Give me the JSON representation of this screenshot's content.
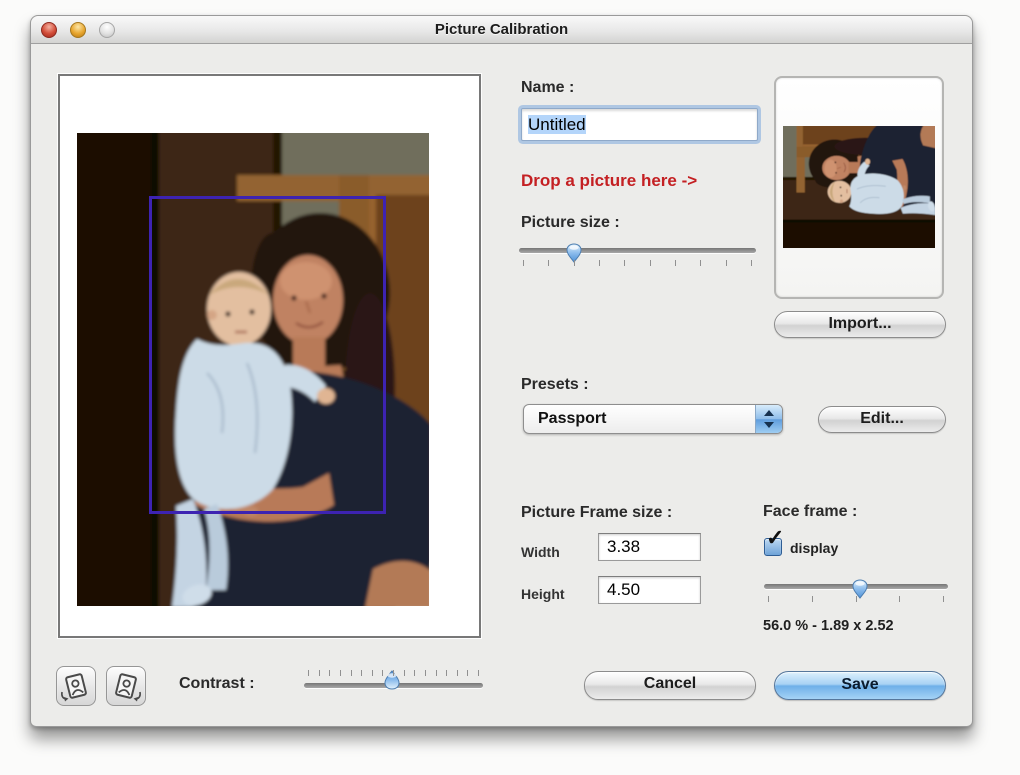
{
  "window": {
    "title": "Picture Calibration",
    "traffic_lights": [
      "close",
      "minimize",
      "zoom"
    ]
  },
  "panel": {
    "name_label": "Name :",
    "name_value": "Untitled",
    "drop_hint": "Drop a picture here ->",
    "picture_size_label": "Picture size :",
    "import_button": "Import...",
    "presets_label": "Presets :",
    "presets_value": "Passport",
    "edit_button": "Edit...",
    "frame_size_label": "Picture Frame size :",
    "width_label": "Width",
    "width_value": "3.38",
    "height_label": "Height",
    "height_value": "4.50",
    "face_frame_label": "Face frame :",
    "display_label": "display",
    "display_checked": true,
    "face_frame_info": "56.0 % - 1.89 x 2.52"
  },
  "bottom": {
    "contrast_label": "Contrast :",
    "cancel_button": "Cancel",
    "save_button": "Save"
  },
  "sliders": {
    "picture_size": {
      "percent": 23,
      "ticks": 10
    },
    "face_frame": {
      "percent": 52,
      "ticks": 5
    },
    "contrast": {
      "percent": 49,
      "ticks": 17
    }
  },
  "icons": {
    "rotate_left": "rotate-picture-left-icon",
    "rotate_right": "rotate-picture-right-icon",
    "stepper": "up-down-stepper-icon",
    "checkbox": "checkmark-icon"
  },
  "colors": {
    "selection_rect": "#3d23b2",
    "drop_hint_red": "#c42023",
    "accent_aqua": "#6fb0e8",
    "text_selection": "#b4d5fa"
  }
}
